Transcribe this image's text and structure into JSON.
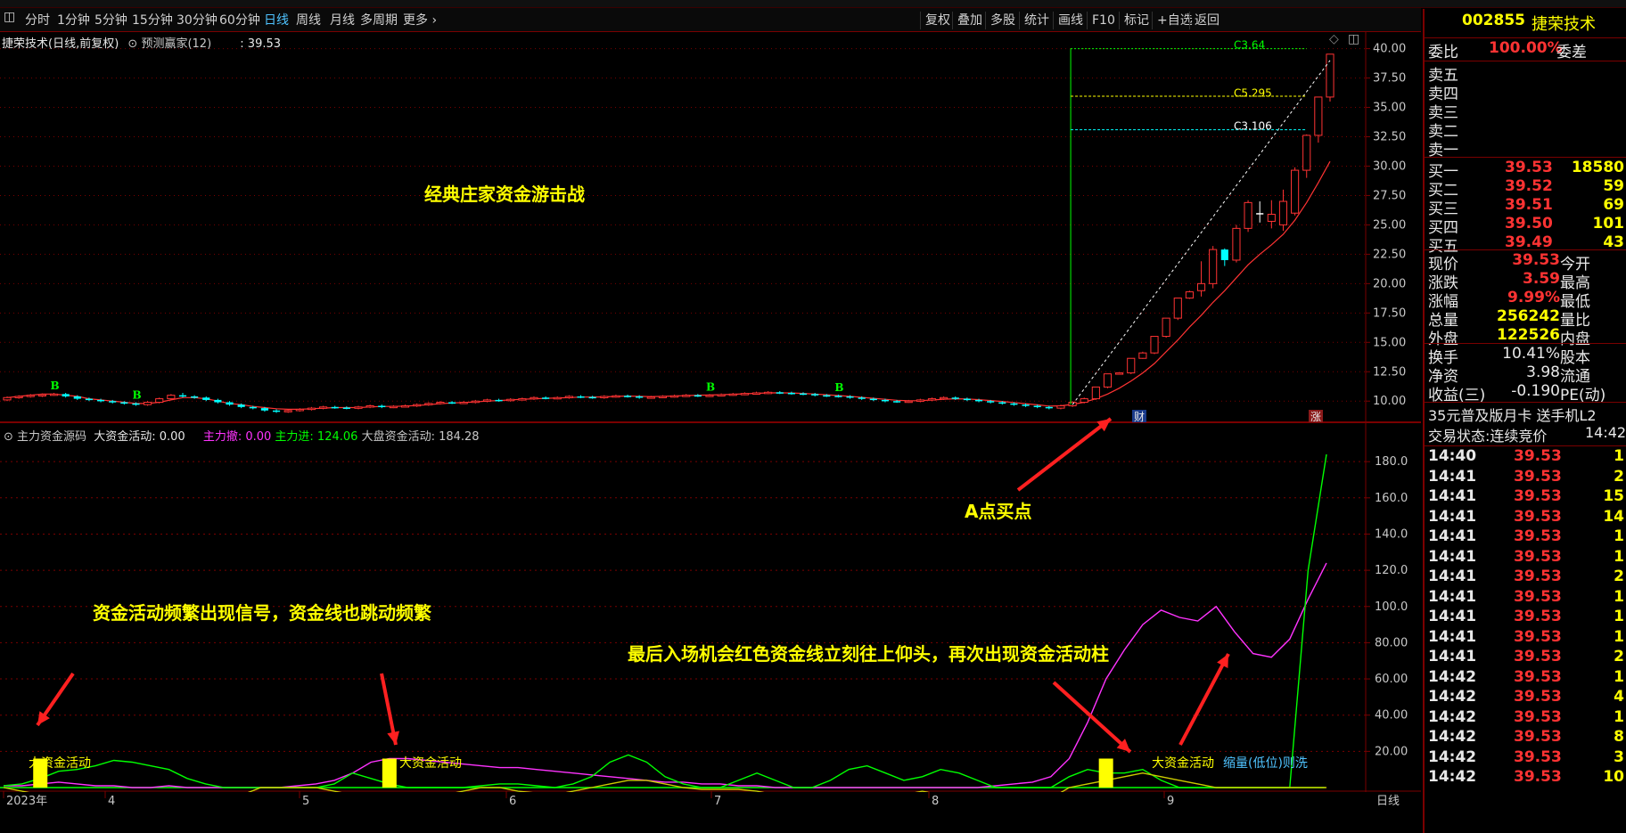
{
  "toolbar": {
    "tabs": [
      "分时",
      "1分钟",
      "5分钟",
      "15分钟",
      "30分钟",
      "60分钟",
      "日线",
      "周线",
      "月线",
      "多周期",
      "更多"
    ],
    "active_tab": "日线",
    "right_buttons": [
      "复权",
      "叠加",
      "多股",
      "统计",
      "画线",
      "F10",
      "标记",
      "+自选",
      "返回"
    ]
  },
  "colors": {
    "up": "#ff3333",
    "down": "#00ffff",
    "grid": "#7a0000",
    "axis_text": "#c8c8c8",
    "flat": "#ffffff",
    "signal_bar": "#ffff00",
    "cash_line": "#ff33ff",
    "green": "#00ff00"
  },
  "main_panel": {
    "header_title": "捷荣技术(日线,前复权)",
    "indicator_name": "预测赢家(12)",
    "indicator_value": ": 39.53",
    "annotation": "经典庄家资金游击战",
    "y_ticks": [
      "40.00",
      "37.50",
      "35.00",
      "32.50",
      "30.00",
      "27.50",
      "25.00",
      "22.50",
      "20.00",
      "17.50",
      "15.00",
      "12.50",
      "10.00"
    ],
    "level_labels": [
      "C3.64",
      "C5.295",
      "C3.106"
    ],
    "badge_cai": "财",
    "badge_zhang": "涨",
    "b_markers": [
      "B",
      "B",
      "B",
      "B"
    ]
  },
  "lower_panel": {
    "header_name": "主力资金源码",
    "items": [
      {
        "label": "大资金活动: 0.00",
        "color": "#e8e8e8"
      },
      {
        "label": "主力撤: 0.00",
        "color": "#ff33ff"
      },
      {
        "label": "主力进: 124.06",
        "color": "#00ff00"
      },
      {
        "label": "大盘资金活动: 184.28",
        "color": "#c8c8c8"
      }
    ],
    "y_ticks": [
      "180.0",
      "160.0",
      "140.0",
      "120.0",
      "100.0",
      "80.00",
      "60.00",
      "40.00",
      "20.00"
    ],
    "annotation_left": "资金活动频繁出现信号，资金线也跳动频繁",
    "annotation_right": "最后入场机会红色资金线立刻往上仰头，再次出现资金活动柱",
    "annotation_buy": "A点买点",
    "signal_label": "大资金活动",
    "signal_label_3": "大资金活动",
    "signal_note": "缩量(低位)则洗"
  },
  "x_axis": {
    "labels": [
      "2023年",
      "4",
      "5",
      "6",
      "7",
      "8",
      "9"
    ],
    "period": "日线"
  },
  "right_panel": {
    "stock_code": "002855",
    "stock_name": "捷荣技术",
    "weibi_label": "委比",
    "weibi_value": "100.00%",
    "weicha_label": "委差",
    "sells": [
      {
        "label": "卖五"
      },
      {
        "label": "卖四"
      },
      {
        "label": "卖三"
      },
      {
        "label": "卖二"
      },
      {
        "label": "卖一"
      }
    ],
    "buys": [
      {
        "label": "买一",
        "price": "39.53",
        "vol": "18580"
      },
      {
        "label": "买二",
        "price": "39.52",
        "vol": "59"
      },
      {
        "label": "买三",
        "price": "39.51",
        "vol": "69"
      },
      {
        "label": "买四",
        "price": "39.50",
        "vol": "101"
      },
      {
        "label": "买五",
        "price": "39.49",
        "vol": "43"
      }
    ],
    "quote": [
      {
        "label": "现价",
        "value": "39.53",
        "label2": "今开"
      },
      {
        "label": "涨跌",
        "value": "3.59",
        "label2": "最高"
      },
      {
        "label": "涨幅",
        "value": "9.99%",
        "label2": "最低"
      },
      {
        "label": "总量",
        "value": "256242",
        "label2": "量比"
      },
      {
        "label": "外盘",
        "value": "122526",
        "label2": "内盘"
      }
    ],
    "finance": [
      {
        "label": "换手",
        "value": "10.41%",
        "label2": "股本"
      },
      {
        "label": "净资",
        "value": "3.98",
        "label2": "流通"
      },
      {
        "label": "收益(三)",
        "value": "-0.190",
        "label2": "PE(动)"
      }
    ],
    "ad_text": "35元普及版月卡 送手机L2",
    "status_label": "交易状态:连续竞价",
    "status_time": "14:42:",
    "ticks": [
      {
        "t": "14:40",
        "p": "39.53",
        "v": "1"
      },
      {
        "t": "14:41",
        "p": "39.53",
        "v": "2"
      },
      {
        "t": "14:41",
        "p": "39.53",
        "v": "15"
      },
      {
        "t": "14:41",
        "p": "39.53",
        "v": "14"
      },
      {
        "t": "14:41",
        "p": "39.53",
        "v": "1"
      },
      {
        "t": "14:41",
        "p": "39.53",
        "v": "1"
      },
      {
        "t": "14:41",
        "p": "39.53",
        "v": "2"
      },
      {
        "t": "14:41",
        "p": "39.53",
        "v": "1"
      },
      {
        "t": "14:41",
        "p": "39.53",
        "v": "1"
      },
      {
        "t": "14:41",
        "p": "39.53",
        "v": "1"
      },
      {
        "t": "14:41",
        "p": "39.53",
        "v": "2"
      },
      {
        "t": "14:42",
        "p": "39.53",
        "v": "1"
      },
      {
        "t": "14:42",
        "p": "39.53",
        "v": "4"
      },
      {
        "t": "14:42",
        "p": "39.53",
        "v": "1"
      },
      {
        "t": "14:42",
        "p": "39.53",
        "v": "8"
      },
      {
        "t": "14:42",
        "p": "39.53",
        "v": "3"
      },
      {
        "t": "14:42",
        "p": "39.53",
        "v": "10"
      }
    ]
  },
  "chart_data": {
    "type": "candlestick",
    "y_range": [
      8.5,
      40.5
    ],
    "candles": [
      [
        10.1,
        10.3,
        10.0,
        10.4
      ],
      [
        10.3,
        10.4,
        10.2,
        10.5
      ],
      [
        10.4,
        10.5,
        10.3,
        10.6
      ],
      [
        10.5,
        10.55,
        10.35,
        10.65
      ],
      [
        10.55,
        10.6,
        10.45,
        10.7
      ],
      [
        10.6,
        10.4,
        10.3,
        10.7
      ],
      [
        10.4,
        10.2,
        10.1,
        10.5
      ],
      [
        10.2,
        10.1,
        10.0,
        10.3
      ],
      [
        10.1,
        10.0,
        9.9,
        10.2
      ],
      [
        10.0,
        9.9,
        9.8,
        10.1
      ],
      [
        9.9,
        9.8,
        9.7,
        10.0
      ],
      [
        9.8,
        9.7,
        9.6,
        9.9
      ],
      [
        9.7,
        9.9,
        9.6,
        10.0
      ],
      [
        9.9,
        10.2,
        9.8,
        10.3
      ],
      [
        10.2,
        10.5,
        10.1,
        10.6
      ],
      [
        10.5,
        10.4,
        10.3,
        10.7
      ],
      [
        10.4,
        10.3,
        10.2,
        10.5
      ],
      [
        10.3,
        10.1,
        10.0,
        10.4
      ],
      [
        10.1,
        9.9,
        9.8,
        10.2
      ],
      [
        9.9,
        9.7,
        9.6,
        10.0
      ],
      [
        9.7,
        9.5,
        9.4,
        9.8
      ],
      [
        9.5,
        9.4,
        9.3,
        9.6
      ],
      [
        9.4,
        9.2,
        9.1,
        9.5
      ],
      [
        9.2,
        9.1,
        9.0,
        9.3
      ],
      [
        9.1,
        9.2,
        9.0,
        9.3
      ],
      [
        9.2,
        9.3,
        9.1,
        9.4
      ],
      [
        9.3,
        9.4,
        9.2,
        9.5
      ],
      [
        9.4,
        9.5,
        9.3,
        9.6
      ],
      [
        9.5,
        9.45,
        9.35,
        9.6
      ],
      [
        9.45,
        9.4,
        9.3,
        9.55
      ],
      [
        9.4,
        9.5,
        9.3,
        9.6
      ],
      [
        9.5,
        9.6,
        9.4,
        9.7
      ],
      [
        9.6,
        9.5,
        9.4,
        9.7
      ],
      [
        9.5,
        9.55,
        9.4,
        9.65
      ],
      [
        9.55,
        9.6,
        9.45,
        9.7
      ],
      [
        9.6,
        9.7,
        9.5,
        9.8
      ],
      [
        9.7,
        9.8,
        9.6,
        9.9
      ],
      [
        9.8,
        9.9,
        9.7,
        10.0
      ],
      [
        9.9,
        9.85,
        9.75,
        10.0
      ],
      [
        9.85,
        9.9,
        9.75,
        10.0
      ],
      [
        9.9,
        10.0,
        9.8,
        10.1
      ],
      [
        10.0,
        10.1,
        9.9,
        10.2
      ],
      [
        10.1,
        10.05,
        9.95,
        10.2
      ],
      [
        10.05,
        10.15,
        9.95,
        10.25
      ],
      [
        10.15,
        10.2,
        10.05,
        10.3
      ],
      [
        10.2,
        10.3,
        10.1,
        10.4
      ],
      [
        10.3,
        10.25,
        10.15,
        10.4
      ],
      [
        10.25,
        10.3,
        10.15,
        10.4
      ],
      [
        10.3,
        10.4,
        10.2,
        10.5
      ],
      [
        10.4,
        10.35,
        10.25,
        10.5
      ],
      [
        10.35,
        10.3,
        10.2,
        10.45
      ],
      [
        10.3,
        10.4,
        10.2,
        10.5
      ],
      [
        10.4,
        10.45,
        10.3,
        10.55
      ],
      [
        10.45,
        10.4,
        10.3,
        10.55
      ],
      [
        10.4,
        10.3,
        10.2,
        10.5
      ],
      [
        10.3,
        10.35,
        10.2,
        10.45
      ],
      [
        10.35,
        10.4,
        10.25,
        10.5
      ],
      [
        10.4,
        10.45,
        10.3,
        10.55
      ],
      [
        10.45,
        10.5,
        10.35,
        10.6
      ],
      [
        10.5,
        10.45,
        10.35,
        10.6
      ],
      [
        10.45,
        10.5,
        10.35,
        10.6
      ],
      [
        10.5,
        10.55,
        10.4,
        10.65
      ],
      [
        10.55,
        10.6,
        10.45,
        10.7
      ],
      [
        10.6,
        10.65,
        10.5,
        10.75
      ],
      [
        10.65,
        10.7,
        10.55,
        10.8
      ],
      [
        10.7,
        10.75,
        10.6,
        10.85
      ],
      [
        10.75,
        10.7,
        10.6,
        10.85
      ],
      [
        10.7,
        10.65,
        10.55,
        10.8
      ],
      [
        10.65,
        10.6,
        10.5,
        10.75
      ],
      [
        10.6,
        10.5,
        10.4,
        10.7
      ],
      [
        10.5,
        10.45,
        10.35,
        10.6
      ],
      [
        10.45,
        10.4,
        10.3,
        10.55
      ],
      [
        10.4,
        10.3,
        10.2,
        10.5
      ],
      [
        10.3,
        10.2,
        10.1,
        10.4
      ],
      [
        10.2,
        10.1,
        10.0,
        10.3
      ],
      [
        10.1,
        10.0,
        9.9,
        10.2
      ],
      [
        10.0,
        9.95,
        9.85,
        10.1
      ],
      [
        9.95,
        10.0,
        9.85,
        10.1
      ],
      [
        10.0,
        10.1,
        9.9,
        10.2
      ],
      [
        10.1,
        10.2,
        10.0,
        10.3
      ],
      [
        10.2,
        10.3,
        10.1,
        10.4
      ],
      [
        10.3,
        10.2,
        10.1,
        10.4
      ],
      [
        10.2,
        10.1,
        10.0,
        10.3
      ],
      [
        10.1,
        10.0,
        9.9,
        10.2
      ],
      [
        10.0,
        9.9,
        9.8,
        10.1
      ],
      [
        9.9,
        9.8,
        9.7,
        10.0
      ],
      [
        9.8,
        9.7,
        9.6,
        9.9
      ],
      [
        9.7,
        9.6,
        9.5,
        9.8
      ],
      [
        9.6,
        9.5,
        9.4,
        9.7
      ],
      [
        9.5,
        9.4,
        9.3,
        9.6
      ],
      [
        9.4,
        9.6,
        9.3,
        9.7
      ],
      [
        9.6,
        9.9,
        9.5,
        10.0
      ],
      [
        9.9,
        10.2,
        9.8,
        10.3
      ],
      [
        10.2,
        11.2,
        10.1,
        11.2
      ],
      [
        11.2,
        12.32,
        11.1,
        12.32
      ],
      [
        12.32,
        12.4,
        12.3,
        12.4
      ],
      [
        12.4,
        13.64,
        12.3,
        13.64
      ],
      [
        13.64,
        14.1,
        13.6,
        14.2
      ],
      [
        14.1,
        15.51,
        14.0,
        15.51
      ],
      [
        15.51,
        17.06,
        15.4,
        17.06
      ],
      [
        17.06,
        18.77,
        16.9,
        18.77
      ],
      [
        18.77,
        19.3,
        18.7,
        19.4
      ],
      [
        19.4,
        20.0,
        18.9,
        21.9
      ],
      [
        20.0,
        22.9,
        19.6,
        23.2
      ],
      [
        22.9,
        22.0,
        21.5,
        23.0
      ],
      [
        22.0,
        24.7,
        21.8,
        25.0
      ],
      [
        24.7,
        26.9,
        24.4,
        27.1
      ],
      [
        26.0,
        26.0,
        25.2,
        27.0
      ],
      [
        25.3,
        25.9,
        24.7,
        27.1
      ],
      [
        25.0,
        27.0,
        24.5,
        28.0
      ],
      [
        26.0,
        29.65,
        25.8,
        29.9
      ],
      [
        29.65,
        32.62,
        29.0,
        32.7
      ],
      [
        32.62,
        35.88,
        32.0,
        35.9
      ],
      [
        35.88,
        39.53,
        35.5,
        39.53
      ]
    ],
    "ma_series": [
      10.3,
      10.4,
      10.5,
      10.6,
      10.6,
      10.5,
      10.4,
      10.2,
      10.1,
      10.0,
      9.9,
      9.8,
      9.8,
      9.9,
      10.1,
      10.3,
      10.3,
      10.2,
      10.0,
      9.8,
      9.7,
      9.55,
      9.45,
      9.35,
      9.3,
      9.3,
      9.35,
      9.4,
      9.45,
      9.45,
      9.45,
      9.5,
      9.55,
      9.55,
      9.58,
      9.62,
      9.7,
      9.78,
      9.84,
      9.88,
      9.93,
      10.0,
      10.05,
      10.1,
      10.15,
      10.2,
      10.24,
      10.27,
      10.3,
      10.34,
      10.35,
      10.36,
      10.4,
      10.43,
      10.4,
      10.38,
      10.4,
      10.43,
      10.47,
      10.5,
      10.52,
      10.55,
      10.58,
      10.62,
      10.66,
      10.7,
      10.71,
      10.69,
      10.65,
      10.6,
      10.54,
      10.47,
      10.4,
      10.32,
      10.24,
      10.15,
      10.07,
      10.03,
      10.04,
      10.09,
      10.16,
      10.2,
      10.18,
      10.12,
      10.05,
      9.97,
      9.88,
      9.78,
      9.68,
      9.58,
      9.6,
      9.72,
      9.9,
      10.2,
      10.6,
      11.1,
      11.7,
      12.4,
      13.2,
      14.2,
      15.2,
      16.3,
      17.3,
      18.4,
      19.4,
      20.5,
      21.6,
      22.5,
      23.3,
      24.2,
      25.4,
      26.9,
      28.6,
      30.4
    ],
    "lower_y_range": [
      0,
      185
    ],
    "lower_series": [
      {
        "name": "主力撤",
        "color": "#ff33ff",
        "values": [
          1,
          1,
          2,
          3,
          2,
          1,
          1,
          0,
          0,
          1,
          0,
          0,
          0,
          0,
          0,
          0,
          1,
          2,
          4,
          8,
          14,
          16,
          16,
          15,
          14,
          13,
          12,
          11,
          11,
          10,
          9,
          8,
          7,
          6,
          5,
          4,
          3,
          3,
          2,
          2,
          1,
          1,
          0,
          0,
          0,
          0,
          0,
          0,
          0,
          0,
          0,
          0,
          0,
          0,
          1,
          2,
          3,
          6,
          16,
          36,
          60,
          76,
          90,
          98,
          94,
          92,
          100,
          86,
          74,
          72,
          82,
          104,
          124
        ]
      },
      {
        "name": "主力进",
        "color": "#00ff00",
        "values": [
          1,
          2,
          5,
          9,
          10,
          12,
          15,
          14,
          12,
          10,
          5,
          2,
          0,
          0,
          0,
          0,
          0,
          0,
          2,
          8,
          5,
          2,
          0,
          0,
          0,
          0,
          1,
          2,
          2,
          1,
          0,
          2,
          6,
          14,
          18,
          14,
          6,
          2,
          0,
          0,
          4,
          8,
          4,
          0,
          0,
          4,
          10,
          12,
          8,
          4,
          6,
          10,
          8,
          4,
          0,
          0,
          0,
          0,
          6,
          10,
          8,
          8,
          10,
          4,
          0,
          0,
          0,
          0,
          0,
          0,
          0,
          120,
          184
        ]
      },
      {
        "name": "大盘资金活动",
        "color": "#cccc00",
        "values": [
          0,
          -2,
          -4,
          -6,
          -8,
          -10,
          -11,
          -12,
          -12,
          -11,
          -8,
          -5,
          -5,
          -4,
          0,
          0,
          0,
          0,
          -2,
          -4,
          -6,
          -8,
          -8,
          -6,
          -4,
          -2,
          0,
          0,
          -2,
          -3,
          -4,
          -2,
          0,
          2,
          4,
          4,
          2,
          0,
          -1,
          -1,
          -1,
          -2,
          -4,
          -6,
          -8,
          -10,
          -9,
          -8,
          -6,
          -4,
          -2,
          -4,
          -8,
          -10,
          -11,
          -10,
          -8,
          -6,
          0,
          2,
          4,
          6,
          8,
          6,
          4,
          2,
          0,
          0,
          0,
          0,
          0,
          0,
          0
        ]
      }
    ],
    "signal_bars": [
      {
        "x_index": 2,
        "value": 16
      },
      {
        "x_index": 21,
        "value": 16
      },
      {
        "x_index": 60,
        "value": 16
      }
    ]
  }
}
